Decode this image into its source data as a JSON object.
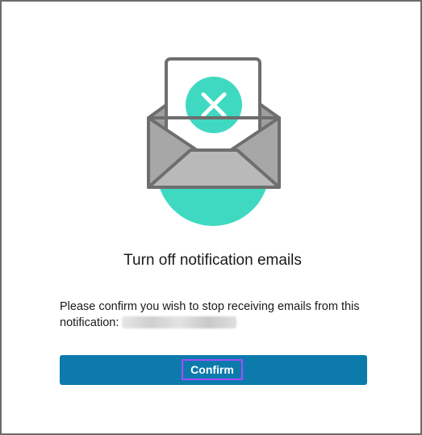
{
  "dialog": {
    "title": "Turn off notification emails",
    "message": "Please confirm you wish to stop receiving emails from this notification:",
    "confirm_label": "Confirm"
  },
  "illustration": {
    "icon": "envelope-with-x-icon",
    "accent_color": "#3fd9c2",
    "envelope_color": "#b9b9b9"
  },
  "colors": {
    "button": "#0c7bac",
    "focus_ring": "#a64dff"
  }
}
